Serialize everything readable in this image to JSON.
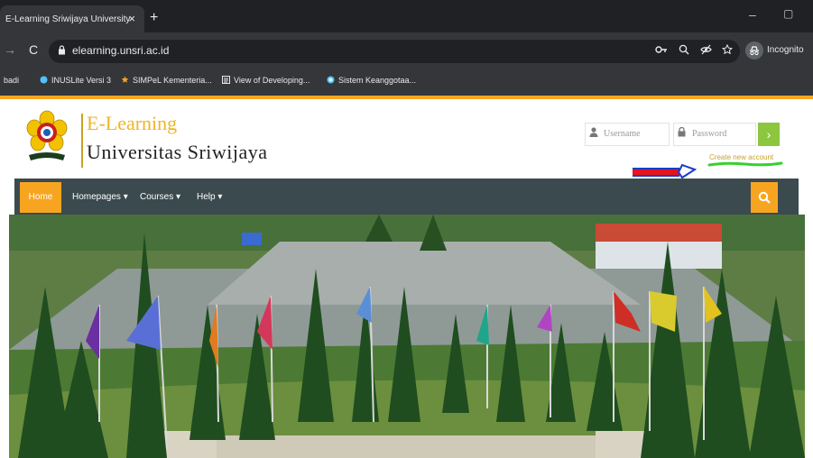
{
  "browser": {
    "tab_title": "E-Learning Sriwijaya University",
    "tab_close": "×",
    "new_tab": "+",
    "minimize": "–",
    "maximize": "▢",
    "forward": "→",
    "reload": "C",
    "url": "elearning.unsri.ac.id",
    "profile_label": "Incognito",
    "bookmarks": [
      {
        "label": "badi",
        "icon": "bookmark-icon",
        "color": "#9aa0a6"
      },
      {
        "label": "INUSLite Versi 3",
        "icon": "site-icon",
        "color": "#4fc3f7"
      },
      {
        "label": "SIMPeL Kementeria...",
        "icon": "star-icon",
        "color": "#f7a520"
      },
      {
        "label": "View of Developing...",
        "icon": "doc-icon",
        "color": "#e8eaed"
      },
      {
        "label": "Sistem Keanggotaa...",
        "icon": "globe-icon",
        "color": "#4fc3f7"
      }
    ]
  },
  "site": {
    "brand_line1": "E-Learning",
    "brand_line2": "Universitas Sriwijaya",
    "login": {
      "username_placeholder": "Username",
      "password_placeholder": "Password",
      "submit_glyph": "›",
      "create_account": "Create new account"
    },
    "nav": {
      "home": "Home",
      "items": [
        "Homepages ▾",
        "Courses ▾",
        "Help ▾"
      ]
    },
    "colors": {
      "accent": "#f7a520",
      "navbar": "#3b4a4e",
      "login_button": "#8dc63f",
      "annotation_arrow": "#e3141b",
      "annotation_underline": "#37d12f"
    }
  }
}
